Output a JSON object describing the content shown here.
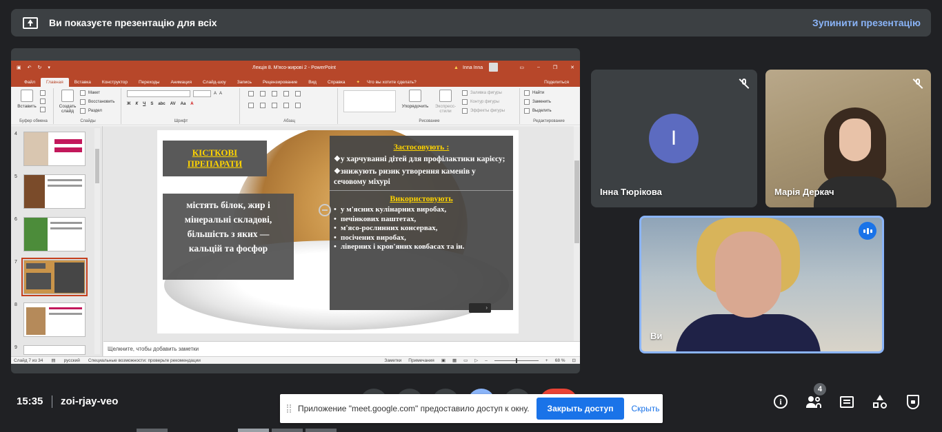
{
  "banner": {
    "text": "Ви показуєте презентацію для всіх",
    "stop_label": "Зупинити презентацію"
  },
  "ppt": {
    "doc_title": "Лекція 8. М'ясо-жирові 2  -  PowerPoint",
    "user": "Inna Inna",
    "tabs": [
      "Файл",
      "Главная",
      "Вставка",
      "Конструктор",
      "Переходы",
      "Анимация",
      "Слайд-шоу",
      "Запись",
      "Рецензирование",
      "Вид",
      "Справка"
    ],
    "tell_me": "Что вы хотите сделать?",
    "share": "Поделиться",
    "ribbon": {
      "paste": "Вставить",
      "clipboard": "Буфер обмена",
      "new_slide": "Создать слайд",
      "layout": "Макет",
      "reset": "Восстановить",
      "section": "Раздел",
      "slides_group": "Слайды",
      "font_group": "Шрифт",
      "paragraph_group": "Абзац",
      "arrange": "Упорядочить",
      "quick_styles": "Экспресс-стили",
      "fill": "Заливка фигуры",
      "outline": "Контур фигуры",
      "effects": "Эффекты фигуры",
      "drawing_group": "Рисование",
      "find": "Найти",
      "replace": "Заменить",
      "select": "Выделить",
      "editing_group": "Редактирование"
    },
    "thumbnails": [
      "4",
      "5",
      "6",
      "7",
      "8",
      "9"
    ],
    "notes_placeholder": "Щелкните, чтобы добавить заметки",
    "status": {
      "slide_info": "Слайд 7 из 34",
      "language": "русский",
      "accessibility": "Специальные возможности: проверьте рекомендации",
      "notes": "Заметки",
      "comments": "Примечания",
      "zoom": "68 %"
    }
  },
  "slide": {
    "title_line1": "КІСТКОВІ",
    "title_line2": "ПРЕПАРАТИ",
    "left_lines": [
      "містять білок, жир і",
      "мінеральні складові,",
      "більшість з яких —",
      "кальцій та фосфор"
    ],
    "applied_heading": "Застосовують :",
    "applied_items": [
      "у харчуванні дітей для профілактики карієсу;",
      "знижують ризик утворення каменів у сечовому міхурі"
    ],
    "used_heading": "Використовують",
    "used_items": [
      "у м'ясних кулінарних виробах,",
      "печінкових паштетах,",
      "м'ясо-рослинних консервах,",
      "посічених виробах,",
      "ліверних і кров'яних ковбасах та ін."
    ]
  },
  "participants": [
    {
      "name": "Інна Тюрікова",
      "avatar_letter": "I",
      "muted": true
    },
    {
      "name": "Марія Деркач",
      "muted": true
    },
    {
      "name": "Ви",
      "speaking": true
    }
  ],
  "bottom": {
    "time": "15:35",
    "meeting_code": "zoi-rjay-veo",
    "people_count": "4"
  },
  "share_notice": {
    "message": "Приложение \"meet.google.com\" предоставило доступ к окну.",
    "close_label": "Закрыть доступ",
    "hide_label": "Скрыть"
  },
  "colors": {
    "accent": "#8ab4f8",
    "ppt_red": "#b7472a",
    "slide_yellow": "#ffd400"
  }
}
